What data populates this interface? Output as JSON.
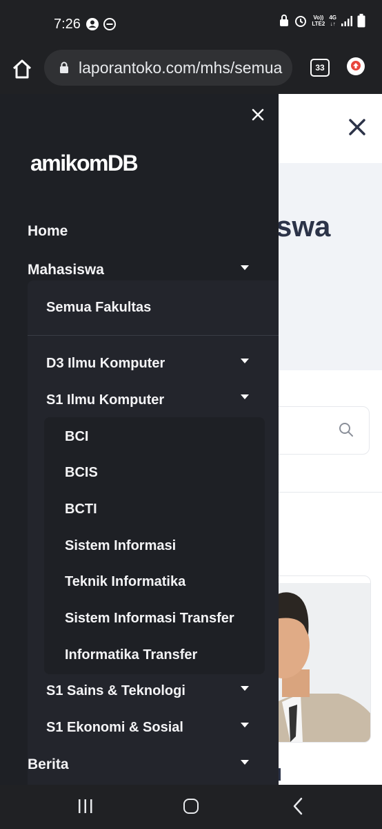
{
  "status_bar": {
    "time": "7:26",
    "volte_top": "Vo))",
    "volte_bottom": "LTE2",
    "network": "4G"
  },
  "browser": {
    "url": "laporantoko.com/mhs/semua",
    "tab_count": "33"
  },
  "page_behind": {
    "title_fragment": "swa",
    "card_name_fragment": "H"
  },
  "drawer": {
    "brand": "amikomDB",
    "items": [
      {
        "label": "Home",
        "level": 0
      },
      {
        "label": "Mahasiswa",
        "level": 0,
        "has_submenu": true,
        "expanded": true
      },
      {
        "label": "Semua Fakultas",
        "level": 1
      },
      {
        "label": "D3 Ilmu Komputer",
        "level": 1,
        "has_submenu": true
      },
      {
        "label": "S1 Ilmu Komputer",
        "level": 1,
        "has_submenu": true,
        "expanded": true
      },
      {
        "label": "BCI",
        "level": 2
      },
      {
        "label": "BCIS",
        "level": 2
      },
      {
        "label": "BCTI",
        "level": 2
      },
      {
        "label": "Sistem Informasi",
        "level": 2
      },
      {
        "label": "Teknik Informatika",
        "level": 2
      },
      {
        "label": "Sistem Informasi Transfer",
        "level": 2
      },
      {
        "label": "Informatika Transfer",
        "level": 2
      },
      {
        "label": "S1 Sains & Teknologi",
        "level": 1,
        "has_submenu": true
      },
      {
        "label": "S1 Ekonomi & Sosial",
        "level": 1,
        "has_submenu": true
      },
      {
        "label": "Berita",
        "level": 0,
        "has_submenu": true
      }
    ]
  },
  "icons": {
    "home": "home-icon",
    "lock": "lock-icon",
    "tabs": "tabs-icon",
    "update": "update-icon",
    "close": "close-icon",
    "search": "search-icon",
    "caret": "caret-down-icon"
  },
  "colors": {
    "drawer_bg": "#1e2025",
    "submenu_bg": "#23252c",
    "browser_chrome": "#202124",
    "update_accent": "#e8453c",
    "page_title": "#2c3348"
  }
}
